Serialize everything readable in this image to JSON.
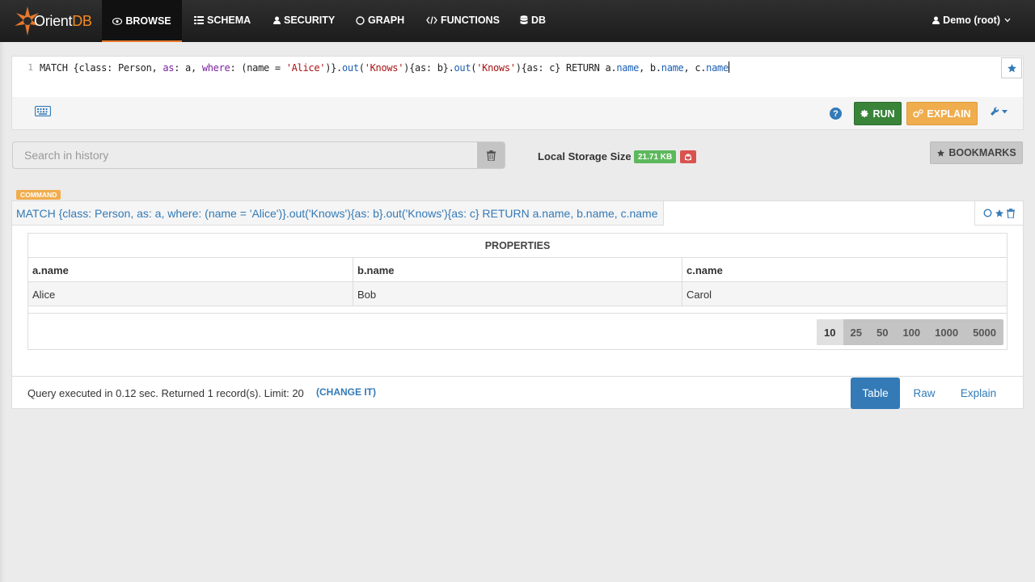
{
  "app": {
    "logo_text": "Orient",
    "logo_suffix": "DB"
  },
  "nav": {
    "items": [
      {
        "label": "BROWSE",
        "icon": "eye-icon",
        "active": true
      },
      {
        "label": "SCHEMA",
        "icon": "schema-icon"
      },
      {
        "label": "SECURITY",
        "icon": "user-icon"
      },
      {
        "label": "GRAPH",
        "icon": "circle-icon"
      },
      {
        "label": "FUNCTIONS",
        "icon": "code-icon"
      },
      {
        "label": "DB",
        "icon": "database-icon"
      }
    ],
    "user": "Demo (root)"
  },
  "editor": {
    "line_number": "1",
    "query": "MATCH {class: Person, as: a, where: (name = 'Alice')}.out('Knows'){as: b}.out('Knows'){as: c} RETURN a.name, b.name, c.name",
    "run_label": "RUN",
    "explain_label": "EXPLAIN"
  },
  "history": {
    "search_placeholder": "Search in history",
    "storage_label": "Local Storage Size",
    "storage_size": "21.71 KB",
    "bookmarks_label": "BOOKMARKS"
  },
  "result": {
    "badge": "COMMAND",
    "query": "MATCH {class: Person, as: a, where: (name = 'Alice')}.out('Knows'){as: b}.out('Knows'){as: c} RETURN a.name, b.name, c.name",
    "properties_header": "PROPERTIES",
    "columns": [
      "a.name",
      "b.name",
      "c.name"
    ],
    "rows": [
      [
        "Alice",
        "Bob",
        "Carol"
      ]
    ],
    "page_sizes": [
      "10",
      "25",
      "50",
      "100",
      "1000",
      "5000"
    ],
    "selected_page_size": "10",
    "footer_text": "Query executed in 0.12 sec. Returned 1 record(s). Limit: 20",
    "change_it": "(CHANGE IT)",
    "view_tabs": [
      "Table",
      "Raw",
      "Explain"
    ],
    "active_view": "Table"
  },
  "colors": {
    "accent": "#337ab7",
    "run": "#398439",
    "explain": "#f0ad4e",
    "nav_active_border": "#e7792b"
  }
}
